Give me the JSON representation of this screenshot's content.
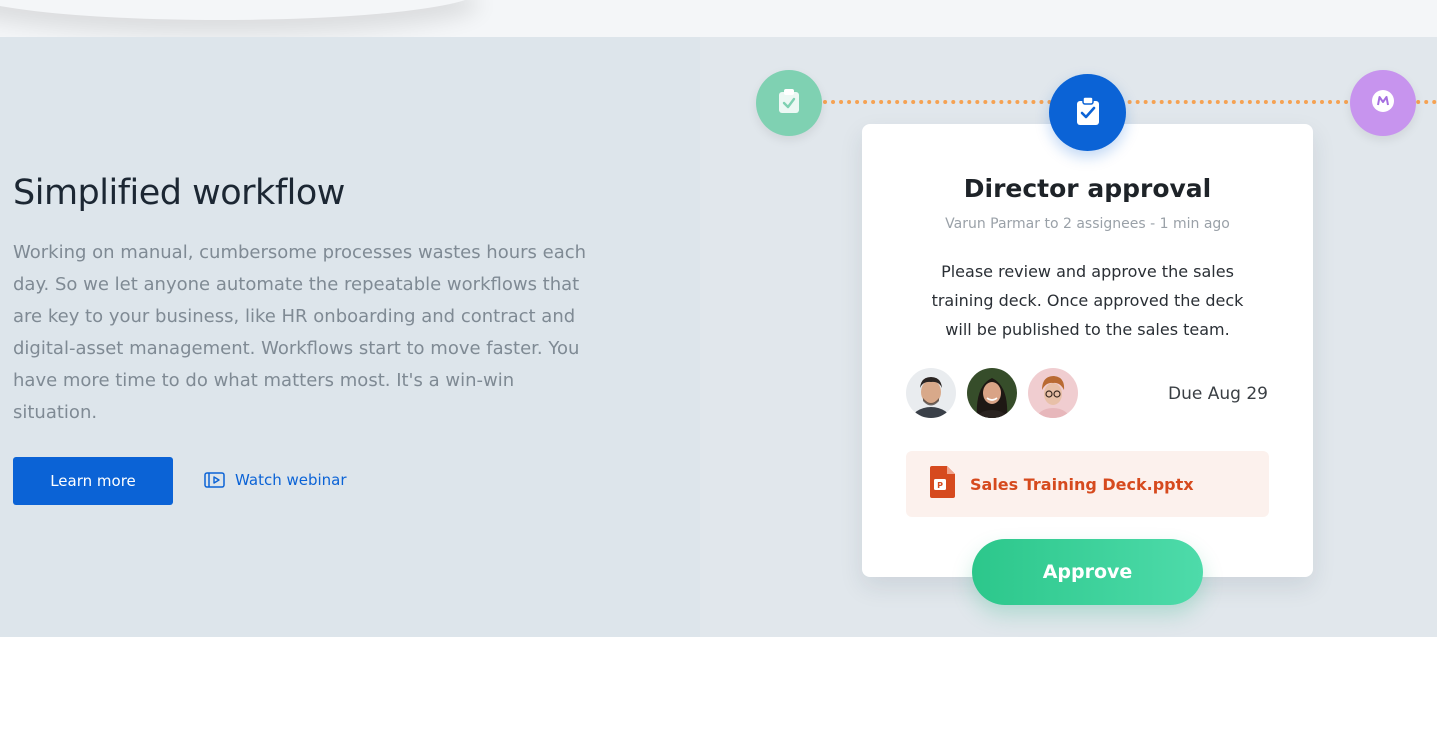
{
  "hero": {
    "title": "Simplified workflow",
    "description": "Working on manual, cumbersome processes wastes hours each day. So we let anyone automate the repeatable workflows that are key to your business, like HR onboarding and contract and digital-asset management. Workflows start to move faster. You have more time to do what matters most. It's a win-win situation.",
    "learn_more_label": "Learn more",
    "watch_webinar_label": "Watch webinar"
  },
  "workflow": {
    "steps": [
      {
        "name": "clipboard-check-icon",
        "color": "#7fd1b2"
      },
      {
        "name": "clipboard-check-icon",
        "color": "#0b63d6"
      },
      {
        "name": "m-logo-icon",
        "color": "#c794ee"
      }
    ],
    "line_color": "#f5a253"
  },
  "card": {
    "title": "Director approval",
    "meta": "Varun Parmar to 2 assignees  - 1 min ago",
    "message": "Please review and approve the sales training deck. Once approved the deck will be published to the sales team.",
    "due": "Due Aug 29",
    "attachment": {
      "name": "Sales Training Deck.pptx",
      "icon": "powerpoint-file-icon"
    },
    "approve_label": "Approve"
  },
  "colors": {
    "accent": "#0b63d6",
    "approve": "#2cc78b",
    "file": "#d64a1e"
  }
}
